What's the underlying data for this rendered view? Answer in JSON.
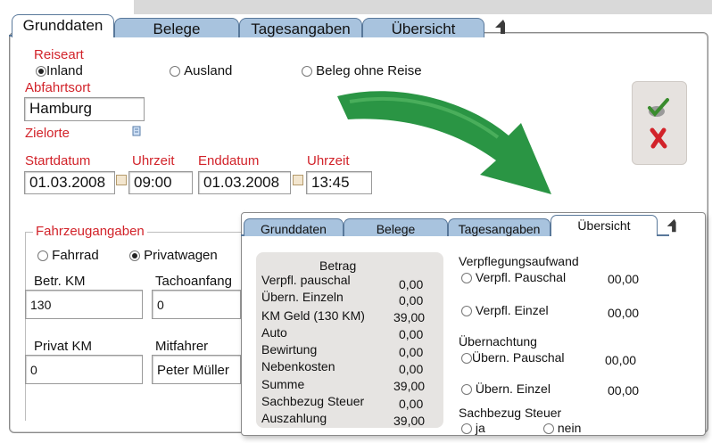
{
  "main": {
    "tabs": [
      {
        "label": "Grunddaten"
      },
      {
        "label": "Belege"
      },
      {
        "label": "Tagesangaben"
      },
      {
        "label": "Übersicht"
      }
    ],
    "reiseart_label": "Reiseart",
    "reiseart_options": [
      {
        "label": "Inland",
        "selected": true
      },
      {
        "label": "Ausland",
        "selected": false
      },
      {
        "label": "Beleg ohne Reise",
        "selected": false
      }
    ],
    "abfahrtsort_label": "Abfahrtsort",
    "abfahrtsort_value": "Hamburg",
    "zielorte_label": "Zielorte",
    "startdatum_label": "Startdatum",
    "startdatum_value": "01.03.2008",
    "uhrzeit1_label": "Uhrzeit",
    "uhrzeit1_value": "09:00",
    "enddatum_label": "Enddatum",
    "enddatum_value": "01.03.2008",
    "uhrzeit2_label": "Uhrzeit",
    "uhrzeit2_value": "13:45",
    "fahrzeug_label": "Fahrzeugangaben",
    "fahrzeug_options": [
      {
        "label": "Fahrrad",
        "selected": false
      },
      {
        "label": "Privatwagen",
        "selected": true
      }
    ],
    "betr_km_label": "Betr. KM",
    "betr_km_value": "130",
    "tachoanfang_label": "Tachoanfang",
    "tachoanfang_value": "0",
    "privat_km_label": "Privat KM",
    "privat_km_value": "0",
    "mitfahrer_label": "Mitfahrer",
    "mitfahrer_value": "Peter Müller"
  },
  "overlay": {
    "tabs": [
      {
        "label": "Grunddaten"
      },
      {
        "label": "Belege"
      },
      {
        "label": "Tagesangaben"
      },
      {
        "label": "Übersicht"
      }
    ],
    "betrag_header": "Betrag",
    "rows": [
      {
        "label": "Verpfl. pauschal",
        "value": "0,00"
      },
      {
        "label": "Übern. Einzeln",
        "value": "0,00"
      },
      {
        "label": "KM Geld (130 KM)",
        "value": "39,00"
      },
      {
        "label": "Auto",
        "value": "0,00"
      },
      {
        "label": "Bewirtung",
        "value": "0,00"
      },
      {
        "label": "Nebenkosten",
        "value": "0,00"
      },
      {
        "label": "Summe",
        "value": "39,00"
      },
      {
        "label": "Sachbezug Steuer",
        "value": "0,00"
      },
      {
        "label": "Auszahlung",
        "value": "39,00"
      }
    ],
    "verpflegung_title": "Verpflegungsaufwand",
    "verpfl_pauschal_label": "Verpfl. Pauschal",
    "verpfl_pauschal_value": "00,00",
    "verpfl_einzel_label": "Verpfl. Einzel",
    "verpfl_einzel_value": "00,00",
    "uebernachtung_title": "Übernachtung",
    "uebern_pauschal_label": "Übern. Pauschal",
    "uebern_pauschal_value": "00,00",
    "uebern_einzel_label": "Übern. Einzel",
    "uebern_einzel_value": "00,00",
    "sachbezug_title": "Sachbezug Steuer",
    "sachbezug_ja": "ja",
    "sachbezug_nein": "nein"
  },
  "colors": {
    "tab_fill": "#a8c3de",
    "tab_border": "#59789a",
    "label_red": "#d2232a",
    "arrow_green": "#1f8f3a"
  },
  "icons": {
    "back": "arrow-back-icon",
    "confirm": "checkmark-icon",
    "cancel": "red-x-icon",
    "document": "document-icon",
    "calendar": "calendar-icon"
  }
}
